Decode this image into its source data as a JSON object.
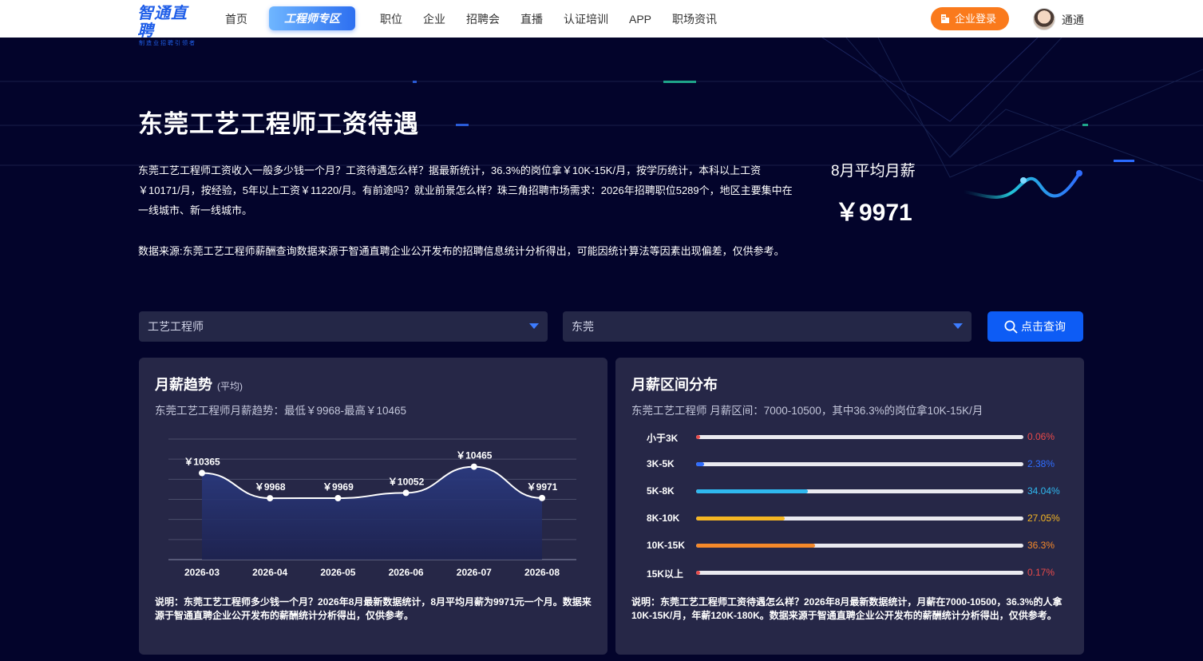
{
  "nav": {
    "logo_main": "智通直聘",
    "logo_sub": "制造业招聘引领者",
    "items": [
      "首页",
      "职位",
      "企业",
      "招聘会",
      "直播",
      "认证培训",
      "APP",
      "职场资讯"
    ],
    "engineer_tag": "工程师专区",
    "login": "企业登录",
    "user": "通通"
  },
  "hero": {
    "title": "东莞工艺工程师工资待遇",
    "description": "东莞工艺工程师工资收入一般多少钱一个月？工资待遇怎么样？据最新统计，36.3%的岗位拿￥10K-15K/月，按学历统计，本科以上工资￥10171/月，按经验，5年以上工资￥11220/月。有前途吗？就业前景怎么样？珠三角招聘市场需求：2026年招聘职位5289个，地区主要集中在一线城市、新一线城市。",
    "source": "数据来源:东莞工艺工程师薪酬查询数据来源于智通直聘企业公开发布的招聘信息统计分析得出，可能因统计算法等因素出现偏差，仅供参考。",
    "avg_label": "8月平均月薪",
    "avg_value": "￥9971"
  },
  "search": {
    "job": "工艺工程师",
    "city": "东莞",
    "button": "点击查询"
  },
  "trend": {
    "title": "月薪趋势",
    "title_note": "(平均)",
    "subtitle": "东莞工艺工程师月薪趋势：最低￥9968-最高￥10465",
    "note": "说明：东莞工艺工程师多少钱一个月？2026年8月最新数据统计，8月平均月薪为9971元一个月。数据来源于智通直聘企业公开发布的薪酬统计分析得出，仅供参考。"
  },
  "distribution": {
    "title": "月薪区间分布",
    "subtitle": "东莞工艺工程师 月薪区间：7000-10500，其中36.3%的岗位拿10K-15K/月",
    "note": "说明：东莞工艺工程师工资待遇怎么样？2026年8月最新数据统计，月薪在7000-10500，36.3%的人拿10K-15K/月，年薪120K-180K。数据来源于智通直聘企业公开发布的薪酬统计分析得出，仅供参考。"
  },
  "chart_data": [
    {
      "type": "area",
      "categories": [
        "2026-03",
        "2026-04",
        "2026-05",
        "2026-06",
        "2026-07",
        "2026-08"
      ],
      "values": [
        10365,
        9968,
        9969,
        10052,
        10465,
        9971
      ],
      "data_labels": [
        "￥10365",
        "￥9968",
        "￥9969",
        "￥10052",
        "￥10465",
        "￥9971"
      ],
      "ylim": [
        0,
        11000
      ],
      "grid": true,
      "colors": {
        "line": "#ffffff",
        "area_top": "#2b3b82",
        "area_bottom": "#1d2250"
      }
    },
    {
      "type": "bar",
      "orientation": "horizontal",
      "categories": [
        "小于3K",
        "3K-5K",
        "5K-8K",
        "8K-10K",
        "10K-15K",
        "15K以上"
      ],
      "values": [
        0.06,
        2.38,
        34.04,
        27.05,
        36.3,
        0.17
      ],
      "labels": [
        "0.06%",
        "2.38%",
        "34.04%",
        "27.05%",
        "36.3%",
        "0.17%"
      ],
      "xlim": [
        0,
        100
      ],
      "colors": [
        "#e84a4a",
        "#2f6dff",
        "#2fb8ef",
        "#f5b623",
        "#f5892a",
        "#e84a4a"
      ]
    }
  ]
}
